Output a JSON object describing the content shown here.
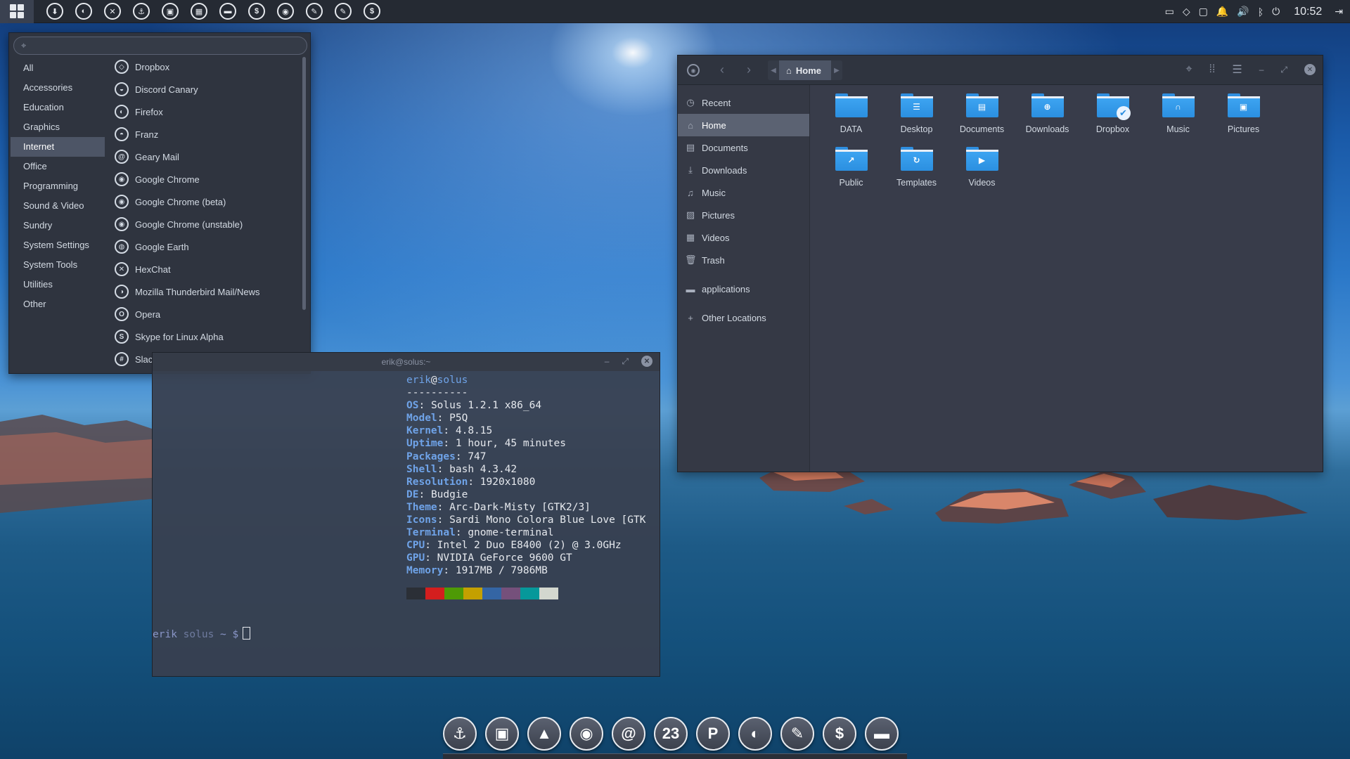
{
  "panel": {
    "launchers": [
      {
        "icon": "download-icon",
        "glyph": "⬇"
      },
      {
        "icon": "firefox-icon",
        "glyph": "◐"
      },
      {
        "icon": "hexchat-icon",
        "glyph": "✕"
      },
      {
        "icon": "anchor-icon",
        "glyph": "⚓"
      },
      {
        "icon": "nautilus-icon",
        "glyph": "▣"
      },
      {
        "icon": "calendar-icon",
        "glyph": "▦"
      },
      {
        "icon": "files-icon",
        "glyph": "▬"
      },
      {
        "icon": "money-icon",
        "glyph": "$"
      },
      {
        "icon": "chrome-icon",
        "glyph": "◉"
      },
      {
        "icon": "pen-icon",
        "glyph": "✎"
      },
      {
        "icon": "pencil-icon",
        "glyph": "✎"
      },
      {
        "icon": "dollar-icon",
        "glyph": "$"
      }
    ],
    "clock": "10:52"
  },
  "app_menu": {
    "search_placeholder": "",
    "categories": [
      "All",
      "Accessories",
      "Education",
      "Graphics",
      "Internet",
      "Office",
      "Programming",
      "Sound & Video",
      "Sundry",
      "System Settings",
      "System Tools",
      "Utilities",
      "Other"
    ],
    "active_category": "Internet",
    "apps": [
      {
        "label": "Dropbox",
        "icon": "dropbox-icon",
        "glyph": "◇"
      },
      {
        "label": "Discord Canary",
        "icon": "discord-icon",
        "glyph": "◒"
      },
      {
        "label": "Firefox",
        "icon": "firefox-icon",
        "glyph": "◐"
      },
      {
        "label": "Franz",
        "icon": "franz-icon",
        "glyph": "◓"
      },
      {
        "label": "Geary Mail",
        "icon": "mail-at-icon",
        "glyph": "@"
      },
      {
        "label": "Google Chrome",
        "icon": "chrome-icon",
        "glyph": "◉"
      },
      {
        "label": "Google Chrome (beta)",
        "icon": "chrome-beta-icon",
        "glyph": "◉"
      },
      {
        "label": "Google Chrome (unstable)",
        "icon": "chrome-unstable-icon",
        "glyph": "◉"
      },
      {
        "label": "Google Earth",
        "icon": "earth-icon",
        "glyph": "◍"
      },
      {
        "label": "HexChat",
        "icon": "hexchat-icon",
        "glyph": "✕"
      },
      {
        "label": "Mozilla Thunderbird Mail/News",
        "icon": "thunderbird-icon",
        "glyph": "◑"
      },
      {
        "label": "Opera",
        "icon": "opera-icon",
        "glyph": "O"
      },
      {
        "label": "Skype for Linux Alpha",
        "icon": "skype-icon",
        "glyph": "S"
      },
      {
        "label": "Slack",
        "icon": "slack-icon",
        "glyph": "#"
      }
    ]
  },
  "terminal": {
    "title": "erik@solus:~",
    "user": "erik",
    "host": "solus",
    "separator": "----------",
    "info": [
      {
        "key": "OS",
        "value": "Solus 1.2.1 x86_64"
      },
      {
        "key": "Model",
        "value": "P5Q"
      },
      {
        "key": "Kernel",
        "value": "4.8.15"
      },
      {
        "key": "Uptime",
        "value": "1 hour, 45 minutes"
      },
      {
        "key": "Packages",
        "value": "747"
      },
      {
        "key": "Shell",
        "value": "bash 4.3.42"
      },
      {
        "key": "Resolution",
        "value": "1920x1080"
      },
      {
        "key": "DE",
        "value": "Budgie"
      },
      {
        "key": "Theme",
        "value": "Arc-Dark-Misty [GTK2/3]"
      },
      {
        "key": "Icons",
        "value": "Sardi Mono Colora Blue Love [GTK"
      },
      {
        "key": "Terminal",
        "value": "gnome-terminal"
      },
      {
        "key": "CPU",
        "value": "Intel 2 Duo E8400 (2) @ 3.0GHz"
      },
      {
        "key": "GPU",
        "value": "NVIDIA GeForce 9600 GT"
      },
      {
        "key": "Memory",
        "value": "1917MB / 7986MB"
      }
    ],
    "palette": [
      "#2b2f36",
      "#d41e1e",
      "#4e9a06",
      "#c4a000",
      "#3465a4",
      "#75507b",
      "#06989a",
      "#d3d7cf"
    ],
    "prompt_user": "erik",
    "prompt_host": "solus",
    "prompt_tail": "~ $"
  },
  "files": {
    "path": "Home",
    "sidebar": [
      {
        "label": "Recent",
        "icon": "clock-icon",
        "glyph": "◷"
      },
      {
        "label": "Home",
        "icon": "home-icon",
        "glyph": "⌂",
        "active": true
      },
      {
        "label": "Documents",
        "icon": "document-icon",
        "glyph": "▤"
      },
      {
        "label": "Downloads",
        "icon": "download-icon",
        "glyph": "⤓"
      },
      {
        "label": "Music",
        "icon": "music-icon",
        "glyph": "♫"
      },
      {
        "label": "Pictures",
        "icon": "picture-icon",
        "glyph": "▨"
      },
      {
        "label": "Videos",
        "icon": "film-icon",
        "glyph": "▦"
      },
      {
        "label": "Trash",
        "icon": "trash-icon",
        "glyph": "🗑"
      }
    ],
    "sidebar_extra": [
      {
        "label": "applications",
        "icon": "folder-icon",
        "glyph": "▬"
      },
      {
        "label": "Other Locations",
        "icon": "plus-icon",
        "glyph": "+"
      }
    ],
    "items": [
      {
        "label": "DATA",
        "emblem": ""
      },
      {
        "label": "Desktop",
        "emblem": "☰"
      },
      {
        "label": "Documents",
        "emblem": "▤"
      },
      {
        "label": "Downloads",
        "emblem": "⊕"
      },
      {
        "label": "Dropbox",
        "emblem": "",
        "check": true
      },
      {
        "label": "Music",
        "emblem": "∩"
      },
      {
        "label": "Pictures",
        "emblem": "▣"
      },
      {
        "label": "Public",
        "emblem": "↗"
      },
      {
        "label": "Templates",
        "emblem": "↻"
      },
      {
        "label": "Videos",
        "emblem": "▶"
      }
    ]
  },
  "dock": [
    {
      "icon": "anchor-icon",
      "glyph": "⚓"
    },
    {
      "icon": "nautilus-icon",
      "glyph": "▣"
    },
    {
      "icon": "vlc-icon",
      "glyph": "▲"
    },
    {
      "icon": "chrome-beta-icon",
      "glyph": "◉"
    },
    {
      "icon": "mail-at-icon",
      "glyph": "@"
    },
    {
      "icon": "calendar-icon",
      "glyph": "23"
    },
    {
      "icon": "p-icon",
      "glyph": "P"
    },
    {
      "icon": "firefox-icon",
      "glyph": "◐"
    },
    {
      "icon": "pen-icon",
      "glyph": "✎"
    },
    {
      "icon": "dollar-icon",
      "glyph": "$"
    },
    {
      "icon": "files-icon",
      "glyph": "▬"
    }
  ]
}
